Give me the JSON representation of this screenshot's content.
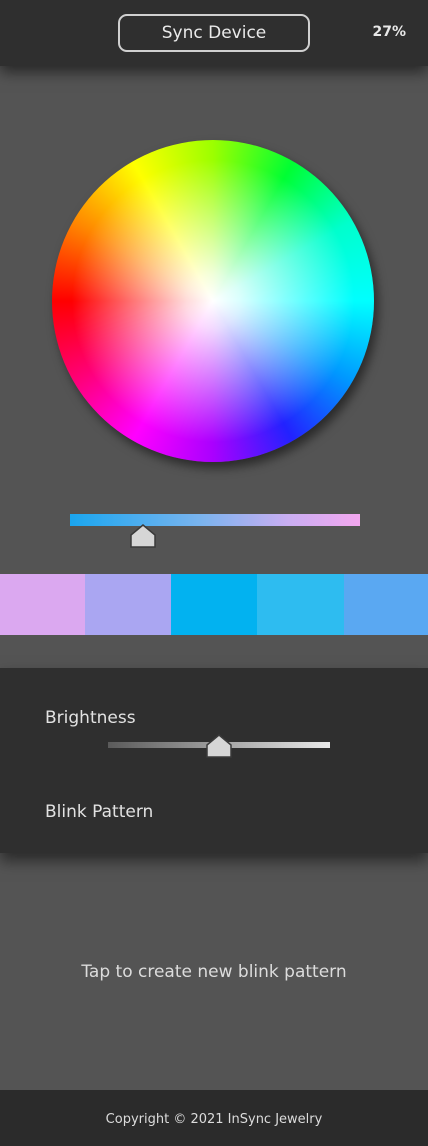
{
  "header": {
    "sync_label": "Sync Device",
    "battery": "27%"
  },
  "color_picker": {
    "hue_slider_level": 0.25,
    "swatches": [
      {
        "color": "#dba8f0"
      },
      {
        "color": "#aaa6f2"
      },
      {
        "color": "#02b2f0"
      },
      {
        "color": "#2ebcf0"
      },
      {
        "color": "#5aa8f2"
      }
    ]
  },
  "controls": {
    "brightness_label": "Brightness",
    "brightness_level": 0.5,
    "blink_pattern_label": "Blink Pattern"
  },
  "pattern": {
    "empty_text": "Tap to create new blink pattern"
  },
  "footer": {
    "copyright": "Copyright © 2021 InSync Jewelry"
  }
}
